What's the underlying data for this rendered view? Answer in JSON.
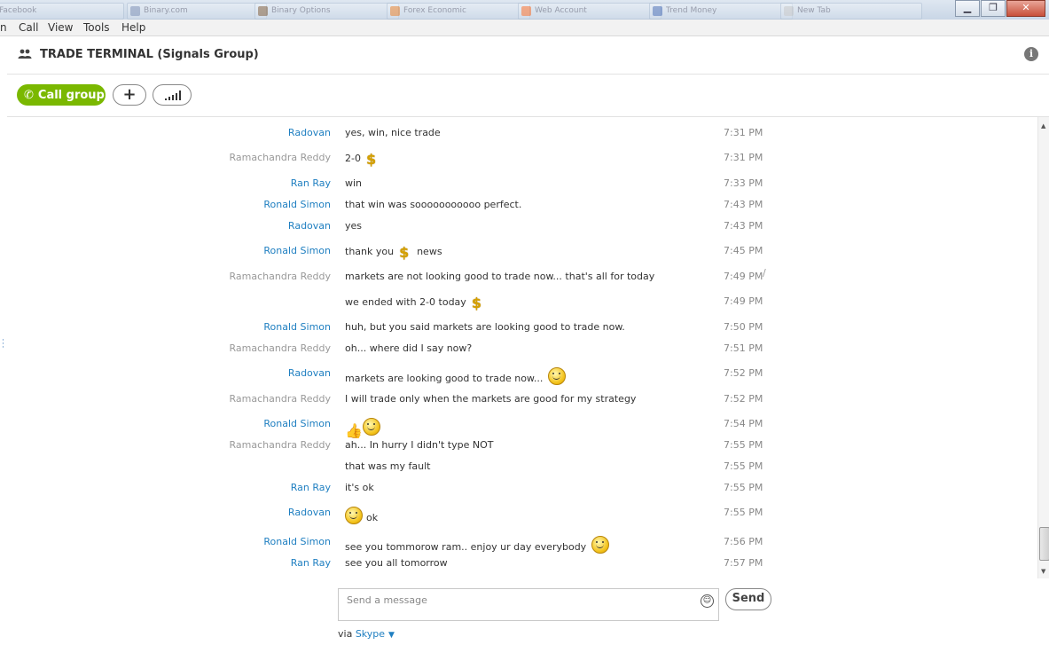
{
  "tabs": [
    {
      "label": "Facebook",
      "color": "#3b5998"
    },
    {
      "label": "Binary.com",
      "color": "#8899bb"
    },
    {
      "label": "Binary Options",
      "color": "#886644"
    },
    {
      "label": "Forex Economic",
      "color": "#ee8833"
    },
    {
      "label": "Web Account",
      "color": "#ff7733"
    },
    {
      "label": "Trend Money",
      "color": "#5577bb"
    },
    {
      "label": "New Tab",
      "color": "#cccccc"
    }
  ],
  "window_controls": {
    "minimize": "▁",
    "maximize": "❐",
    "close": "✕"
  },
  "menu": [
    "n",
    "Call",
    "View",
    "Tools",
    "Help"
  ],
  "header": {
    "title": "TRADE TERMINAL (Signals Group)",
    "info": "i"
  },
  "toolbar": {
    "call_label": "Call group",
    "add_label": "+"
  },
  "messages": [
    {
      "sender": "Radovan",
      "sender_style": "blue",
      "text": "yes, win, nice trade",
      "emoji": "",
      "time": "7:31 PM"
    },
    {
      "sender": "Ramachandra Reddy",
      "sender_style": "grey",
      "text": "2-0",
      "emoji": "dollar",
      "time": "7:31 PM"
    },
    {
      "sender": "Ran Ray",
      "sender_style": "blue",
      "text": "win",
      "emoji": "",
      "time": "7:33 PM"
    },
    {
      "sender": "Ronald Simon",
      "sender_style": "blue",
      "text": "that win was sooooooooooo perfect.",
      "emoji": "",
      "time": "7:43 PM"
    },
    {
      "sender": "Radovan",
      "sender_style": "blue",
      "text": "yes",
      "emoji": "",
      "time": "7:43 PM"
    },
    {
      "sender": "Ronald Simon",
      "sender_style": "blue",
      "text": "thank you",
      "emoji": "dollar",
      "text_after": "news",
      "time": "7:45 PM"
    },
    {
      "sender": "Ramachandra Reddy",
      "sender_style": "grey",
      "text": "markets are not looking good to trade now... that's all for today",
      "emoji": "",
      "time": "7:49 PM",
      "status": "∕"
    },
    {
      "sender": "",
      "sender_style": "grey",
      "text": "we ended with 2-0 today",
      "emoji": "dollar",
      "time": "7:49 PM"
    },
    {
      "sender": "Ronald Simon",
      "sender_style": "blue",
      "text": "huh, but you said markets are looking good to trade now.",
      "emoji": "",
      "time": "7:50 PM"
    },
    {
      "sender": "Ramachandra Reddy",
      "sender_style": "grey",
      "text": "oh... where did I say now?",
      "emoji": "",
      "time": "7:51 PM"
    },
    {
      "sender": "Radovan",
      "sender_style": "blue",
      "text": "markets are looking good to trade now...",
      "emoji": "smile",
      "time": "7:52 PM"
    },
    {
      "sender": "Ramachandra Reddy",
      "sender_style": "grey",
      "text": "I will trade only when the markets are good for my strategy",
      "emoji": "",
      "time": "7:52 PM"
    },
    {
      "sender": "Ronald Simon",
      "sender_style": "blue",
      "text": "",
      "emoji": "thumb-laugh",
      "time": "7:54 PM"
    },
    {
      "sender": "Ramachandra Reddy",
      "sender_style": "grey",
      "text": "ah... In hurry I didn't type NOT",
      "emoji": "",
      "time": "7:55 PM"
    },
    {
      "sender": "",
      "sender_style": "grey",
      "text": "that was my fault",
      "emoji": "",
      "time": "7:55 PM"
    },
    {
      "sender": "Ran Ray",
      "sender_style": "blue",
      "text": "it's ok",
      "emoji": "",
      "time": "7:55 PM"
    },
    {
      "sender": "Radovan",
      "sender_style": "blue",
      "text": "",
      "emoji": "smile-ok",
      "text_after": "ok",
      "time": "7:55 PM"
    },
    {
      "sender": "Ronald Simon",
      "sender_style": "blue",
      "text": "see you tommorow ram.. enjoy ur day everybody",
      "emoji": "smile",
      "time": "7:56 PM"
    },
    {
      "sender": "Ran Ray",
      "sender_style": "blue",
      "text": "see you all tomorrow",
      "emoji": "",
      "time": "7:57 PM"
    }
  ],
  "compose": {
    "placeholder": "Send a message",
    "send_label": "Send"
  },
  "footer": {
    "via": "via",
    "service": "Skype"
  }
}
